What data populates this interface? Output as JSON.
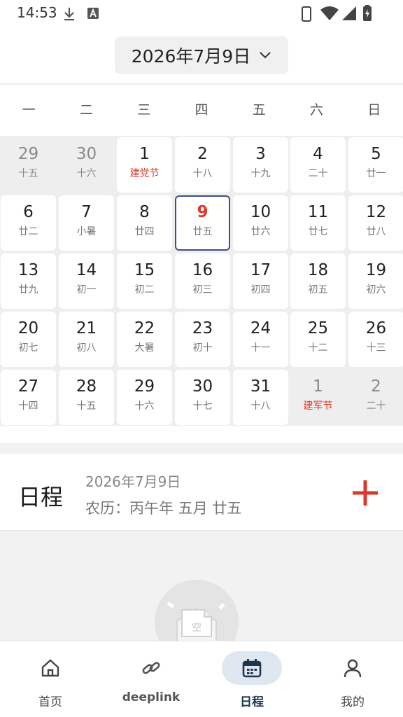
{
  "status": {
    "time": "14:53"
  },
  "header": {
    "date_label": "2026年7月9日"
  },
  "weekdays": [
    "一",
    "二",
    "三",
    "四",
    "五",
    "六",
    "日"
  ],
  "calendar": [
    [
      {
        "day": "29",
        "sub": "十五",
        "other": true
      },
      {
        "day": "30",
        "sub": "十六",
        "other": true
      },
      {
        "day": "1",
        "sub": "建党节",
        "holiday": true
      },
      {
        "day": "2",
        "sub": "十八"
      },
      {
        "day": "3",
        "sub": "十九"
      },
      {
        "day": "4",
        "sub": "二十"
      },
      {
        "day": "5",
        "sub": "廿一"
      }
    ],
    [
      {
        "day": "6",
        "sub": "廿二"
      },
      {
        "day": "7",
        "sub": "小暑"
      },
      {
        "day": "8",
        "sub": "廿四"
      },
      {
        "day": "9",
        "sub": "廿五",
        "selected": true
      },
      {
        "day": "10",
        "sub": "廿六"
      },
      {
        "day": "11",
        "sub": "廿七"
      },
      {
        "day": "12",
        "sub": "廿八"
      }
    ],
    [
      {
        "day": "13",
        "sub": "廿九"
      },
      {
        "day": "14",
        "sub": "初一"
      },
      {
        "day": "15",
        "sub": "初二"
      },
      {
        "day": "16",
        "sub": "初三"
      },
      {
        "day": "17",
        "sub": "初四"
      },
      {
        "day": "18",
        "sub": "初五"
      },
      {
        "day": "19",
        "sub": "初六"
      }
    ],
    [
      {
        "day": "20",
        "sub": "初七"
      },
      {
        "day": "21",
        "sub": "初八"
      },
      {
        "day": "22",
        "sub": "大暑"
      },
      {
        "day": "23",
        "sub": "初十"
      },
      {
        "day": "24",
        "sub": "十一"
      },
      {
        "day": "25",
        "sub": "十二"
      },
      {
        "day": "26",
        "sub": "十三"
      }
    ],
    [
      {
        "day": "27",
        "sub": "十四"
      },
      {
        "day": "28",
        "sub": "十五"
      },
      {
        "day": "29",
        "sub": "十六"
      },
      {
        "day": "30",
        "sub": "十七"
      },
      {
        "day": "31",
        "sub": "十八"
      },
      {
        "day": "1",
        "sub": "建军节",
        "other": true,
        "holiday": true
      },
      {
        "day": "2",
        "sub": "二十",
        "other": true
      }
    ]
  ],
  "schedule": {
    "title": "日程",
    "date": "2026年7月9日",
    "lunar": "农历：丙午年 五月 廿五"
  },
  "empty": {
    "icon_text": "空"
  },
  "nav": [
    {
      "label": "首页",
      "icon": "home-icon"
    },
    {
      "label": "deeplink",
      "icon": "link-icon"
    },
    {
      "label": "日程",
      "icon": "calendar-icon",
      "active": true
    },
    {
      "label": "我的",
      "icon": "person-icon"
    }
  ],
  "colors": {
    "accent": "#d93a2b",
    "selected_border": "#3f4d8a",
    "nav_active_bg": "#dfe7f0"
  }
}
